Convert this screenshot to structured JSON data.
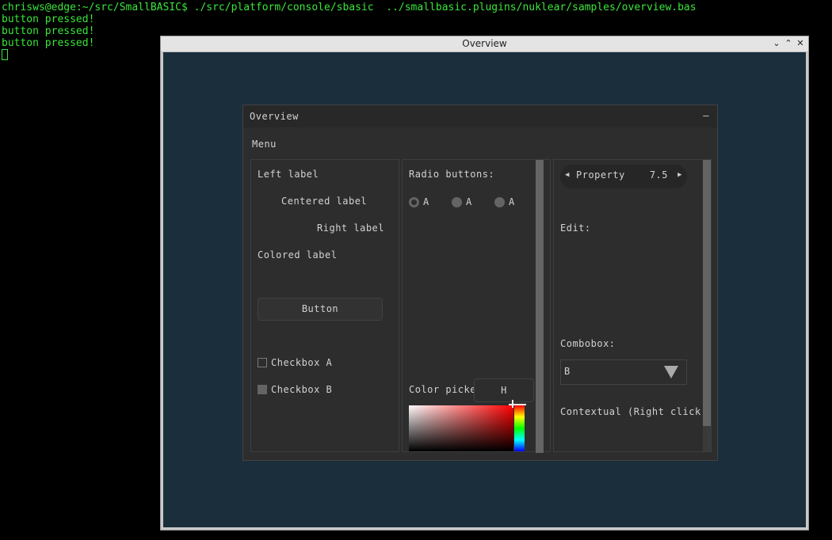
{
  "terminal": {
    "prompt": "chrisws@edge:~/src/SmallBASIC$ ./src/platform/console/sbasic  ../smallbasic.plugins/nuklear/samples/overview.bas",
    "lines": [
      "button pressed!",
      "button pressed!",
      "button pressed!"
    ]
  },
  "window": {
    "title": "Overview",
    "buttons": {
      "minimize": "⌄",
      "maximize": "⌃",
      "close": "✕"
    }
  },
  "panel": {
    "title": "Overview",
    "minimize": "–",
    "menu": "Menu"
  },
  "labels": {
    "left": "Left label",
    "centered": "Centered label",
    "right": "Right label",
    "colored": "Colored label",
    "button": "Button",
    "checkbox_a": "Checkbox A",
    "checkbox_b": "Checkbox B",
    "checkbox_a_checked": false,
    "checkbox_b_checked": true
  },
  "middle": {
    "radio_title": "Radio buttons:",
    "radios": [
      {
        "label": "A",
        "selected": true
      },
      {
        "label": "A",
        "selected": false
      },
      {
        "label": "A",
        "selected": false
      }
    ],
    "color_picker": "Color picker",
    "hue_button": "H"
  },
  "right": {
    "property_name": "Property",
    "property_value": "7.5",
    "edit": "Edit:",
    "combobox_label": "Combobox:",
    "combobox_value": "B",
    "contextual": "Contextual (Right click"
  },
  "colors": {
    "terminal_text": "#39e639",
    "client_bg": "#1b2e3c",
    "panel_bg": "#2d2d2d"
  }
}
